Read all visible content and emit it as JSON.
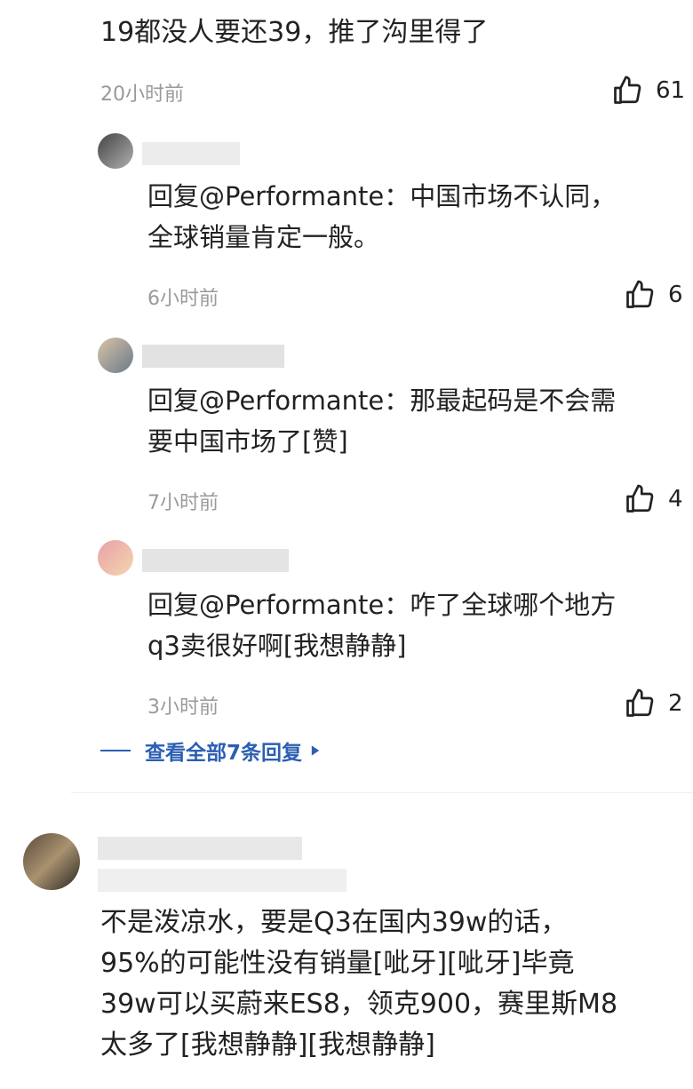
{
  "top_comment": {
    "text": "19都没人要还39，推了沟里得了",
    "time": "20小时前",
    "likes": "61"
  },
  "replies": [
    {
      "text_line1": "回复@Performante：中国市场不认同，",
      "text_line2": "全球销量肯定一般。",
      "time": "6小时前",
      "likes": "6"
    },
    {
      "text_line1": "回复@Performante：那最起码是不会需",
      "text_line2": "要中国市场了[赞]",
      "time": "7小时前",
      "likes": "4"
    },
    {
      "text_line1": "回复@Performante：咋了全球哪个地方",
      "text_line2": "q3卖很好啊[我想静静]",
      "time": "3小时前",
      "likes": "2"
    }
  ],
  "view_all": {
    "label": "查看全部7条回复"
  },
  "next_comment": {
    "line1": "不是泼凉水，要是Q3在国内39w的话，",
    "line2": "95%的可能性没有销量[呲牙][呲牙]毕竟",
    "line3": "39w可以买蔚来ES8，领克900，赛里斯M8",
    "line4": "太多了[我想静静][我想静静]"
  },
  "icons": {
    "like": "thumbs-up-icon",
    "expand": "triangle-right-icon"
  },
  "colors": {
    "link": "#2b5fb3",
    "time": "#9a9a9a",
    "text": "#222222"
  }
}
